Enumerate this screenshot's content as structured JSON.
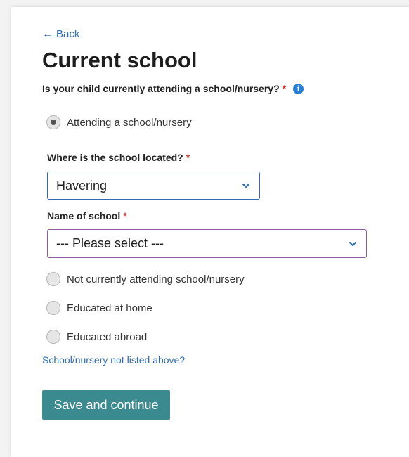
{
  "nav": {
    "back_label": "Back"
  },
  "page": {
    "title": "Current school"
  },
  "question": {
    "label": "Is your child currently attending a school/nursery?",
    "required_mark": "*"
  },
  "options": {
    "attending": "Attending a school/nursery",
    "not_attending": "Not currently attending school/nursery",
    "home": "Educated at home",
    "abroad": "Educated abroad"
  },
  "location": {
    "label": "Where is the school located?",
    "required_mark": "*",
    "value": "Havering"
  },
  "school": {
    "label": "Name of school",
    "required_mark": "*",
    "value": "--- Please select ---"
  },
  "links": {
    "not_listed": "School/nursery not listed above?"
  },
  "actions": {
    "save_label": "Save and continue"
  },
  "colors": {
    "link": "#2e6db4",
    "button": "#3a8a8f",
    "required": "#d0342c",
    "info": "#2a7fd4"
  }
}
